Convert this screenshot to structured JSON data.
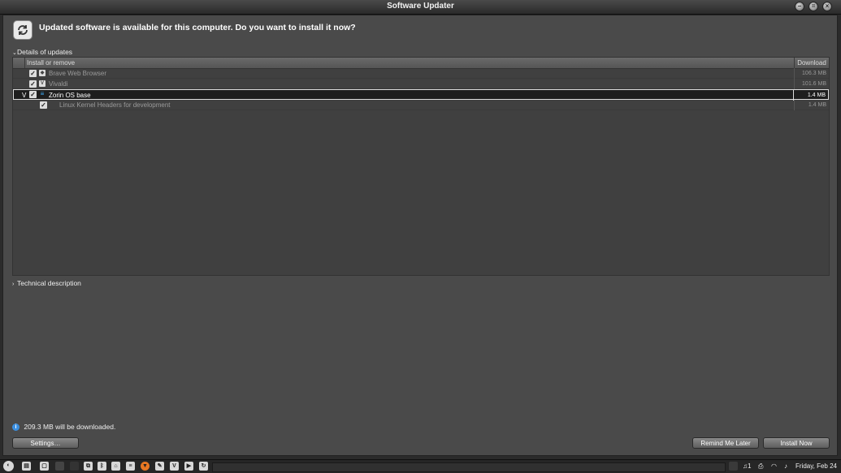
{
  "window": {
    "title": "Software Updater",
    "heading": "Updated software is available for this computer. Do you want to install it now?"
  },
  "details": {
    "label": "Details of updates"
  },
  "columns": {
    "install": "Install or remove",
    "download": "Download"
  },
  "updates": [
    {
      "name": "Brave Web Browser",
      "size": "106.3 MB",
      "icon": "brave-icon"
    },
    {
      "name": "Vivaldi",
      "size": "101.6 MB",
      "icon": "vivaldi-icon"
    },
    {
      "name": "Zorin OS base",
      "size": "1.4 MB",
      "icon": "zorin-icon",
      "expander": "V"
    },
    {
      "name": "Linux Kernel Headers for development",
      "size": "1.4 MB"
    }
  ],
  "technical": {
    "label": "Technical description"
  },
  "status": {
    "download_text": "209.3 MB will be downloaded."
  },
  "buttons": {
    "settings": "Settings…",
    "remind": "Remind Me Later",
    "install": "Install Now"
  },
  "taskbar": {
    "notifications": "1",
    "clock": "Friday, Feb 24"
  }
}
